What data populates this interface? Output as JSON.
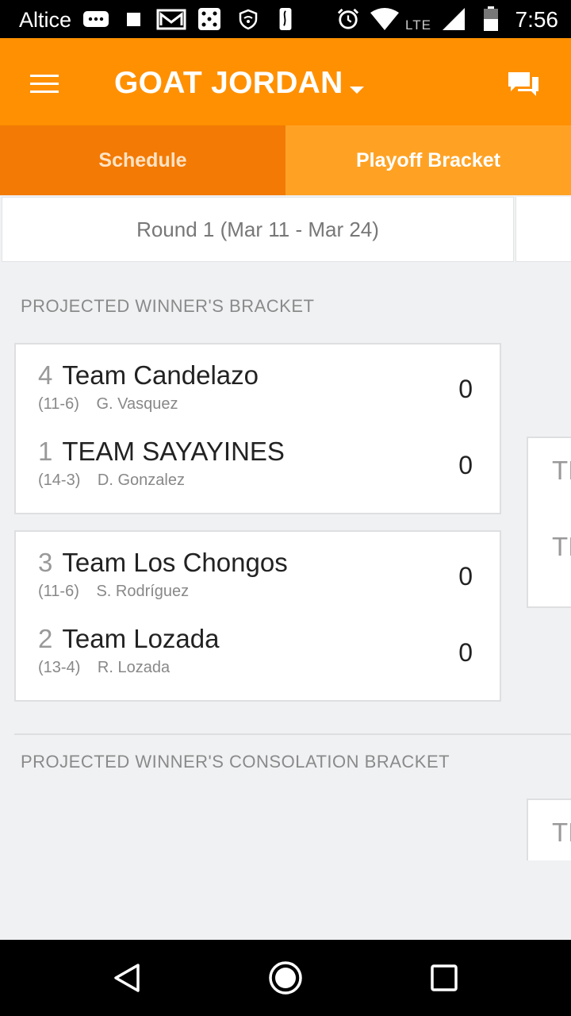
{
  "status_bar": {
    "carrier": "Altice",
    "network": "LTE",
    "time": "7:56"
  },
  "app_bar": {
    "team_title": "GOAT JORDAN"
  },
  "tabs": [
    {
      "label": "Schedule",
      "selected": false
    },
    {
      "label": "Playoff Bracket",
      "selected": true
    }
  ],
  "round": {
    "label": "Round 1 (Mar 11 - Mar 24)"
  },
  "winners_bracket": {
    "heading": "PROJECTED WINNER'S BRACKET",
    "matchups": [
      {
        "teams": [
          {
            "seed": "4",
            "name": "Team Candelazo",
            "record": "(11-6)",
            "manager": "G. Vasquez",
            "score": "0"
          },
          {
            "seed": "1",
            "name": "TEAM SAYAYINES",
            "record": "(14-3)",
            "manager": "D. Gonzalez",
            "score": "0"
          }
        ]
      },
      {
        "teams": [
          {
            "seed": "3",
            "name": "Team Los Chongos",
            "record": "(11-6)",
            "manager": "S. Rodríguez",
            "score": "0"
          },
          {
            "seed": "2",
            "name": "Team Lozada",
            "record": "(13-4)",
            "manager": "R. Lozada",
            "score": "0"
          }
        ]
      }
    ],
    "next_round_abbr": [
      "TI",
      "TI"
    ]
  },
  "consolation_bracket": {
    "heading": "PROJECTED WINNER'S CONSOLATION BRACKET",
    "next_round_abbr": [
      "TI"
    ]
  },
  "colors": {
    "brand_orange": "#ff9001",
    "tab_active": "#ffa224",
    "tab_inactive": "#f27a05"
  }
}
